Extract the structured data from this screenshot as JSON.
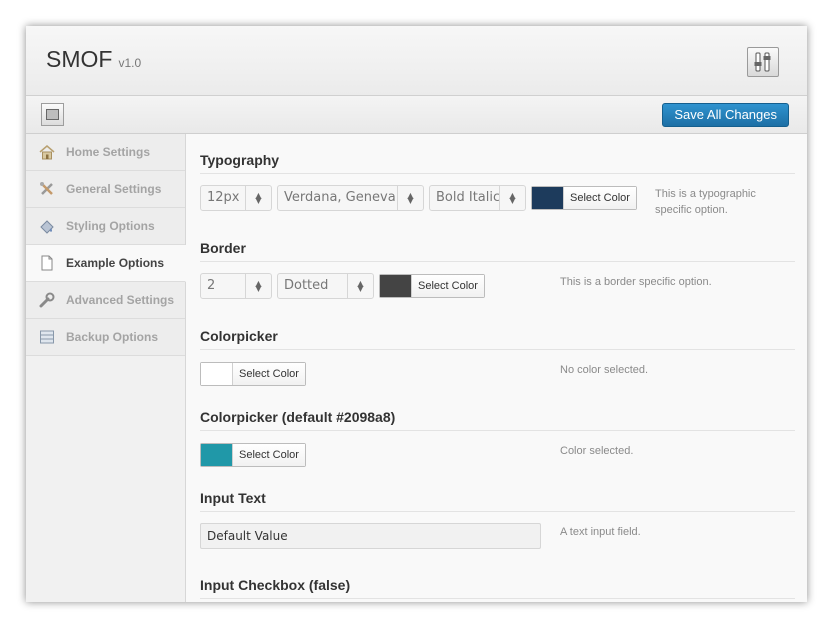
{
  "header": {
    "title": "SMOF",
    "version": "v1.0"
  },
  "toolbar": {
    "save_label": "Save All Changes"
  },
  "sidebar": {
    "items": [
      {
        "label": "Home Settings",
        "icon": "home-icon"
      },
      {
        "label": "General Settings",
        "icon": "tools-icon"
      },
      {
        "label": "Styling Options",
        "icon": "paint-icon"
      },
      {
        "label": "Example Options",
        "icon": "document-icon",
        "active": true
      },
      {
        "label": "Advanced Settings",
        "icon": "wrench-icon"
      },
      {
        "label": "Backup Options",
        "icon": "backup-icon"
      }
    ]
  },
  "main": {
    "typography": {
      "title": "Typography",
      "size": "12px",
      "face": "Verdana, Geneva",
      "style": "Bold Italic",
      "color": "#1d3b5c",
      "color_label": "Select Color",
      "desc": "This is a typographic specific option."
    },
    "border": {
      "title": "Border",
      "width": "2",
      "style": "Dotted",
      "color": "#444444",
      "color_label": "Select Color",
      "desc": "This is a border specific option."
    },
    "colorpicker": {
      "title": "Colorpicker",
      "color": "#ffffff",
      "color_label": "Select Color",
      "desc": "No color selected."
    },
    "colorpicker_default": {
      "title": "Colorpicker (default #2098a8)",
      "color": "#2098a8",
      "color_label": "Select Color",
      "desc": "Color selected."
    },
    "input_text": {
      "title": "Input Text",
      "value": "Default Value",
      "desc": "A text input field."
    },
    "input_checkbox": {
      "title": "Input Checkbox (false)"
    }
  },
  "colors": {
    "accent": "#2384c0",
    "active_nav_text": "#444444",
    "inactive_nav_text": "#a4a4a4"
  }
}
